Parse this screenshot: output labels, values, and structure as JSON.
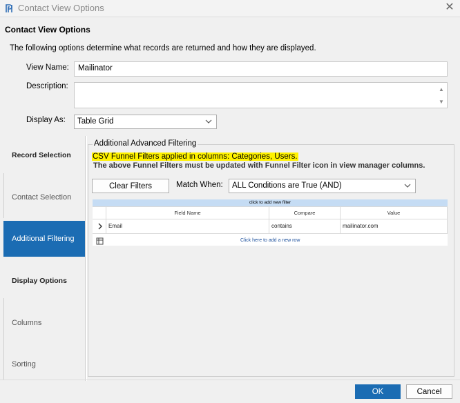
{
  "window": {
    "title": "Contact View Options",
    "close_icon": "close-icon"
  },
  "dialog": {
    "heading": "Contact View Options",
    "intro": "The following options determine what records are returned and how they are displayed."
  },
  "form": {
    "view_name_label": "View Name:",
    "view_name_value": "Mailinator",
    "description_label": "Description:",
    "description_value": "",
    "display_as_label": "Display As:",
    "display_as_value": "Table Grid"
  },
  "nav": {
    "record_selection": "Record Selection",
    "contact_selection": "Contact  Selection",
    "additional_filtering": "Additional  Filtering",
    "display_options": "Display Options",
    "columns": "Columns",
    "sorting": "Sorting"
  },
  "filtering": {
    "group_title": "Additional Advanced Filtering",
    "notice_line1": "CSV Funnel Filters applied in columns: Categories, Users.",
    "notice_line2": "The above Funnel Filters must be updated with Funnel Filter icon in view manager columns.",
    "clear_filters_label": "Clear Filters",
    "match_when_label": "Match When:",
    "match_when_value": "ALL Conditions are True (AND)"
  },
  "grid": {
    "add_filter_bar": "click to add new filter",
    "columns": [
      "Field Name",
      "Compare",
      "Value"
    ],
    "rows": [
      {
        "field": "Email",
        "compare": "contains",
        "value": "mailinator.com"
      }
    ],
    "add_row_link": "Click here to add a new row"
  },
  "buttons": {
    "ok": "OK",
    "cancel": "Cancel"
  },
  "colors": {
    "accent": "#1b6cb3",
    "highlight": "#fff200",
    "grid_header": "#c5dcf4"
  }
}
